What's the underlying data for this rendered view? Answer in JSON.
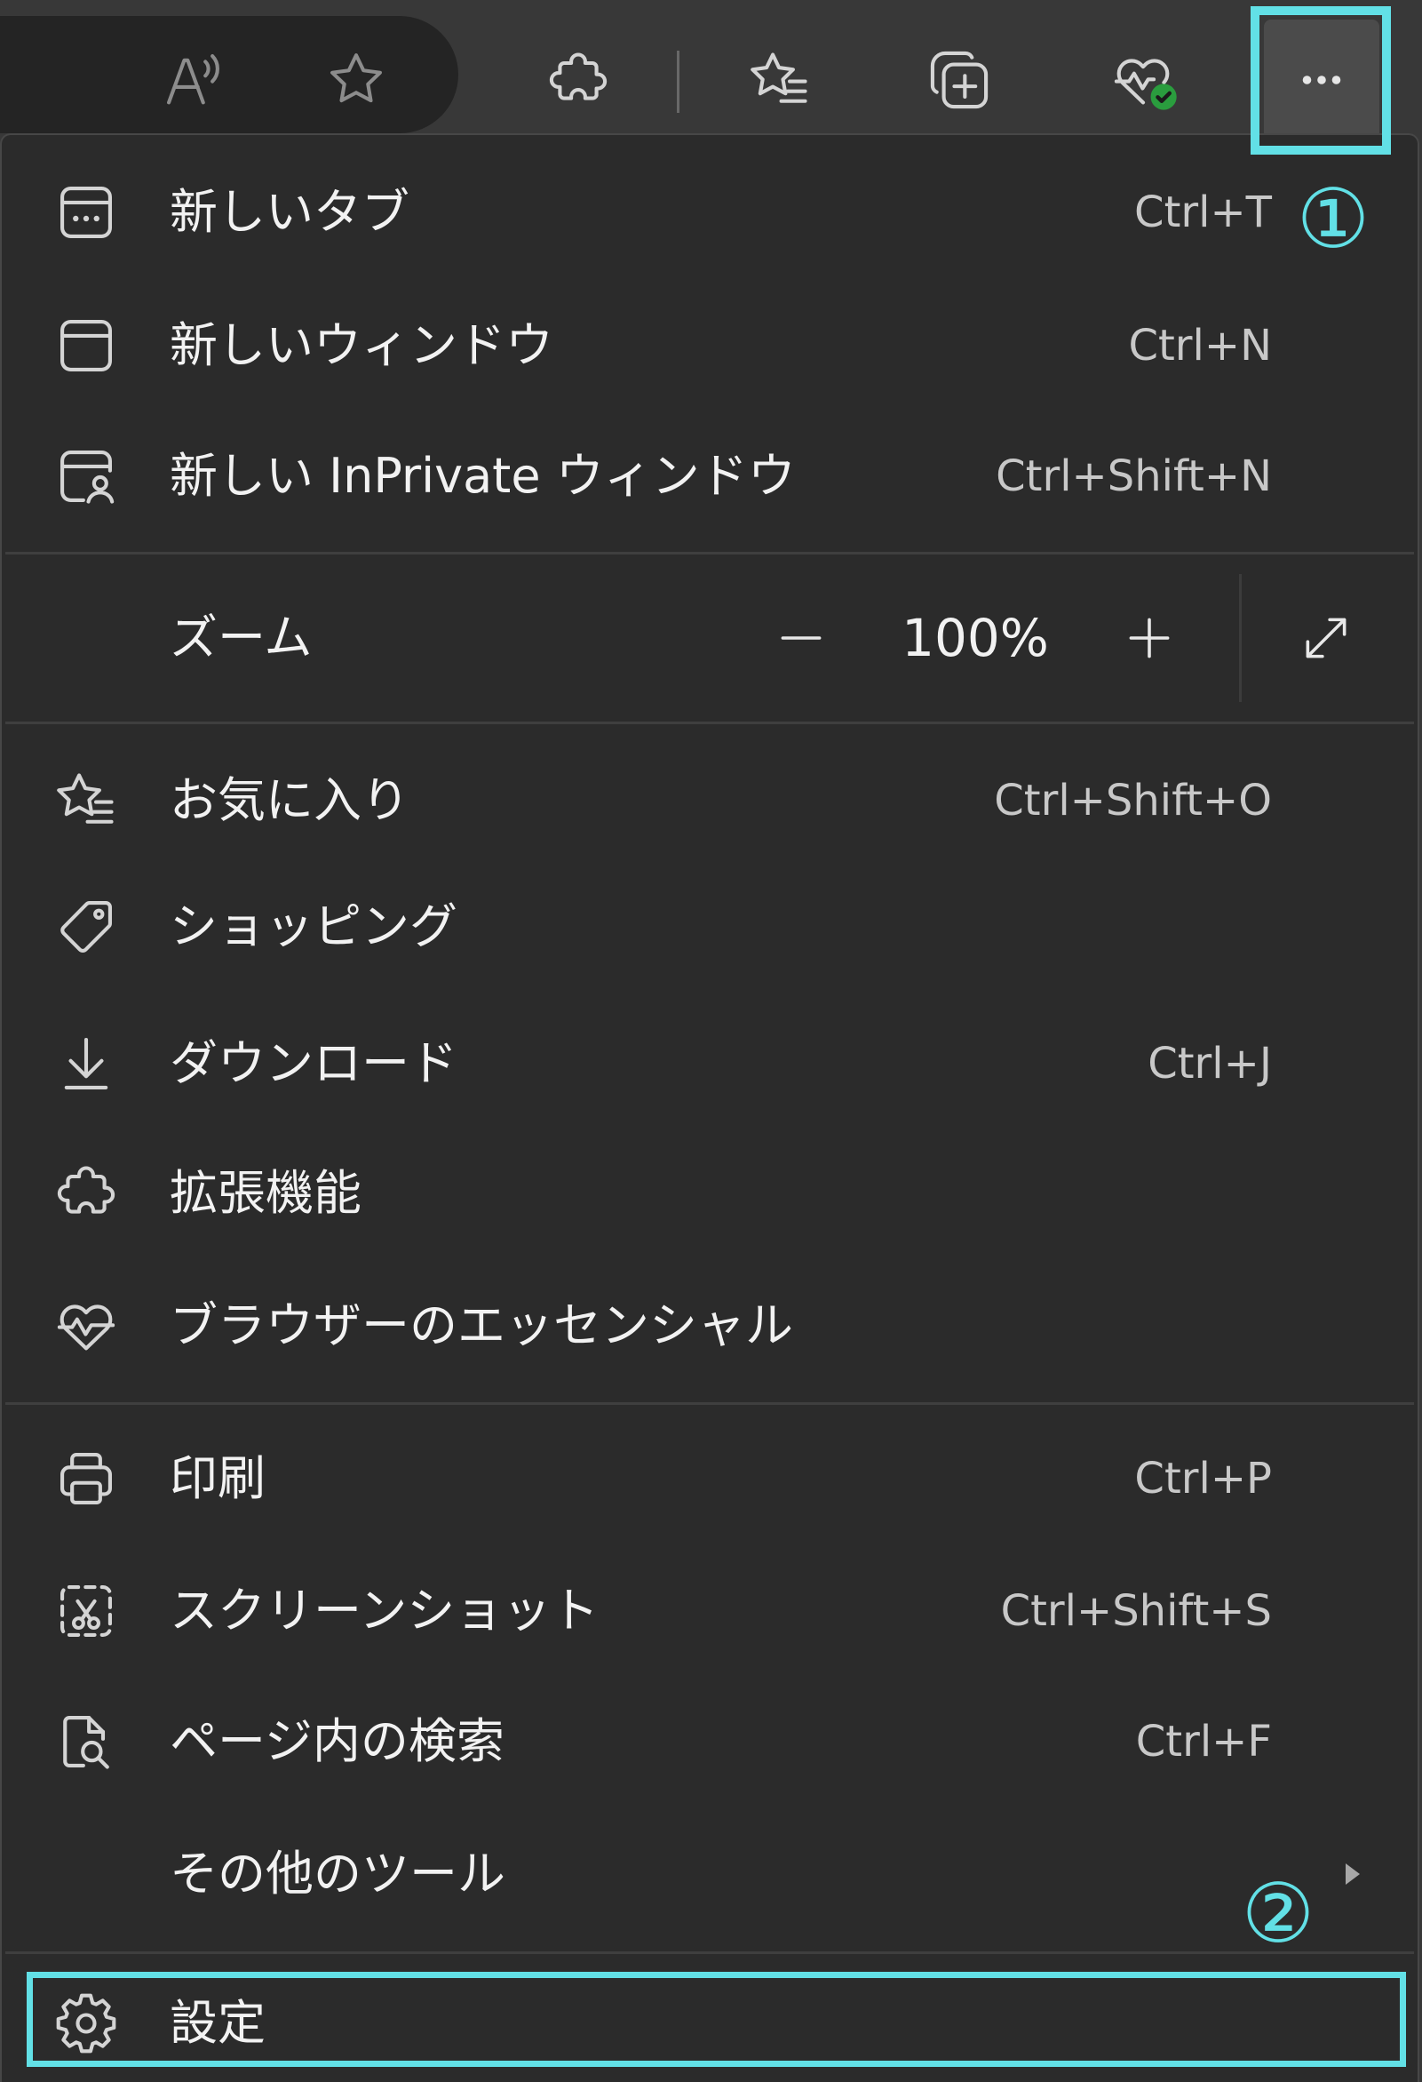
{
  "toolbar": {
    "icons": [
      "read-aloud-icon",
      "add-favorite-icon",
      "extensions-icon",
      "favorites-icon",
      "collections-icon",
      "browser-essentials-icon",
      "more-icon"
    ]
  },
  "menu": {
    "new_tab": {
      "label": "新しいタブ",
      "shortcut": "Ctrl+T",
      "icon": "new-tab-icon"
    },
    "new_window": {
      "label": "新しいウィンドウ",
      "shortcut": "Ctrl+N",
      "icon": "new-window-icon"
    },
    "new_inprivate_window": {
      "label": "新しい InPrivate ウィンドウ",
      "shortcut": "Ctrl+Shift+N",
      "icon": "inprivate-icon"
    },
    "zoom": {
      "label": "ズーム",
      "value": "100%",
      "decrease_icon": "minus-icon",
      "increase_icon": "plus-icon",
      "fullscreen_icon": "expand-icon"
    },
    "favorites": {
      "label": "お気に入り",
      "shortcut": "Ctrl+Shift+O",
      "icon": "favorites-icon"
    },
    "shopping": {
      "label": "ショッピング",
      "icon": "tag-icon"
    },
    "downloads": {
      "label": "ダウンロード",
      "shortcut": "Ctrl+J",
      "icon": "download-icon"
    },
    "extensions": {
      "label": "拡張機能",
      "icon": "puzzle-icon"
    },
    "browser_essentials": {
      "label": "ブラウザーのエッセンシャル",
      "icon": "heart-pulse-icon"
    },
    "print": {
      "label": "印刷",
      "shortcut": "Ctrl+P",
      "icon": "printer-icon"
    },
    "screenshot": {
      "label": "スクリーンショット",
      "shortcut": "Ctrl+Shift+S",
      "icon": "screenshot-icon"
    },
    "find_on_page": {
      "label": "ページ内の検索",
      "shortcut": "Ctrl+F",
      "icon": "find-in-page-icon"
    },
    "more_tools": {
      "label": "その他のツール",
      "icon": "chevron-right-icon"
    },
    "settings": {
      "label": "設定",
      "icon": "gear-icon"
    }
  },
  "annotations": {
    "step_1": "①",
    "step_2": "②"
  },
  "colors": {
    "toolbar_background": "#383838",
    "address_bar_background": "#242424",
    "menu_background": "#2b2b2b",
    "menu_border": "#474747",
    "divider": "#3f3f3f",
    "label_text": "#f2f2f2",
    "shortcut_text": "#c8c8c8",
    "icon": "#d4d4d4",
    "icon_dim": "#8c8c8c",
    "more_button_background": "#4b4b4b",
    "annotation_accent": "#62e0e6",
    "essentials_badge": "#2a9d3e"
  }
}
